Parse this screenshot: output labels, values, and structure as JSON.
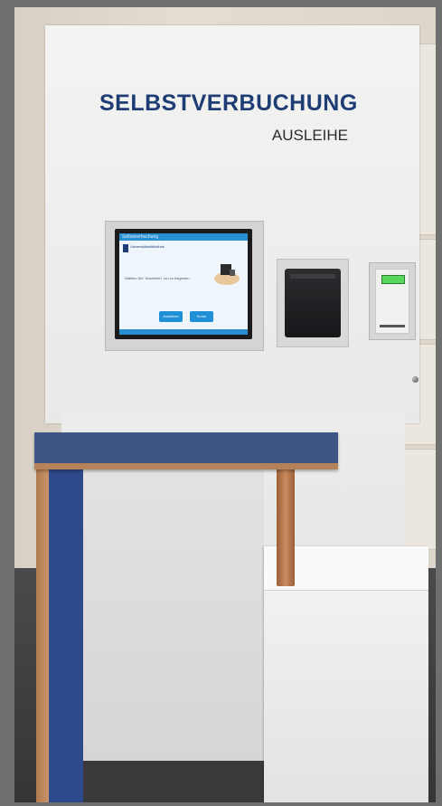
{
  "kiosk": {
    "title": "SELBSTVERBUCHUNG",
    "subtitle": "AUSLEIHE"
  },
  "screen": {
    "topbar_text": "Selbstverbuchung",
    "logo_text": "Universitätsbibliothek",
    "prompt": "Wählen Sie \"Ausleihen\" um zu beginnen",
    "buttons": [
      "Ausleihen",
      "Konto"
    ],
    "colors": {
      "accent": "#1f8fd6",
      "brand": "#1f3d75"
    }
  },
  "card_reader": {
    "display_color": "#58d85b"
  },
  "desk": {
    "top_color": "#3e5586",
    "wood_color": "#b5825a"
  }
}
